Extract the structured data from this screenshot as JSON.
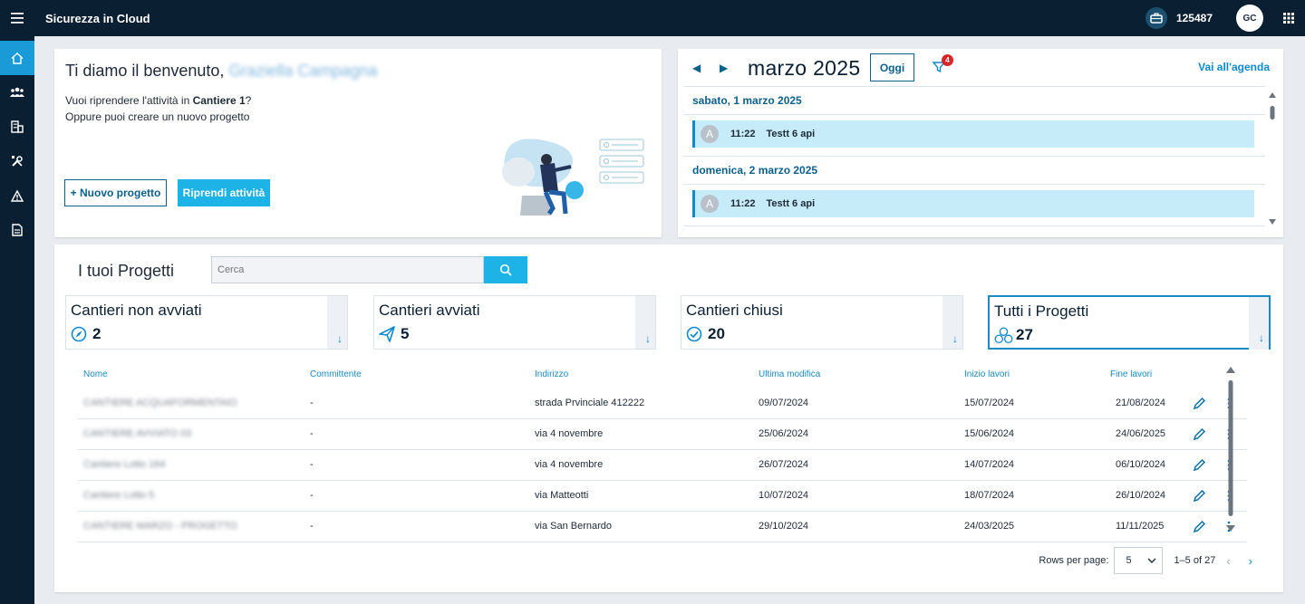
{
  "app": {
    "title": "Sicurezza in Cloud",
    "code": "125487",
    "user_initials": "GC"
  },
  "sidebar": {
    "items": [
      {
        "icon": "home-icon",
        "active": true
      },
      {
        "icon": "users-icon",
        "active": false
      },
      {
        "icon": "buildings-icon",
        "active": false
      },
      {
        "icon": "tools-icon",
        "active": false
      },
      {
        "icon": "warning-icon",
        "active": false
      },
      {
        "icon": "document-icon",
        "active": false
      }
    ]
  },
  "welcome": {
    "greeting": "Ti diamo il benvenuto,",
    "user_name": "Graziella Campagna",
    "resume_prefix": "Vuoi riprendere l'attività in ",
    "resume_site": "Cantiere 1",
    "resume_suffix": "?",
    "create_line": "Oppure puoi creare un nuovo progetto",
    "new_project_label": "+ Nuovo progetto",
    "resume_label": "Riprendi attività"
  },
  "agenda": {
    "month": "marzo 2025",
    "today_label": "Oggi",
    "filter_count": "4",
    "goto_label": "Vai all'agenda",
    "days": [
      {
        "label": "sabato, 1 marzo 2025",
        "events": [
          {
            "avatar": "A",
            "time": "11:22",
            "title": "Testt 6 api"
          }
        ]
      },
      {
        "label": "domenica, 2 marzo 2025",
        "events": [
          {
            "avatar": "A",
            "time": "11:22",
            "title": "Testt 6 api"
          }
        ]
      }
    ]
  },
  "projects": {
    "title": "I tuoi Progetti",
    "search_placeholder": "Cerca",
    "tiles": [
      {
        "label": "Cantieri non avviati",
        "count": "2",
        "icon": "compass-icon",
        "selected": false
      },
      {
        "label": "Cantieri avviati",
        "count": "5",
        "icon": "paper-plane-icon",
        "selected": false
      },
      {
        "label": "Cantieri chiusi",
        "count": "20",
        "icon": "check-circle-icon",
        "selected": false
      },
      {
        "label": "Tutti i Progetti",
        "count": "27",
        "icon": "circles-icon",
        "selected": true
      }
    ],
    "columns": [
      "Nome",
      "Committente",
      "Indirizzo",
      "Ultima modifica",
      "Inizio lavori",
      "Fine lavori"
    ],
    "rows": [
      {
        "name": "CANTIERE ACQUAFORMENTAIO",
        "client": "-",
        "address": "strada Prvinciale 412222",
        "modified": "09/07/2024",
        "start": "15/07/2024",
        "end": "21/08/2024"
      },
      {
        "name": "CANTIERE AVVIATO 03",
        "client": "-",
        "address": "via 4 novembre",
        "modified": "25/06/2024",
        "start": "15/06/2024",
        "end": "24/06/2025"
      },
      {
        "name": "Cantiere Lotto 164",
        "client": "-",
        "address": "via 4 novembre",
        "modified": "26/07/2024",
        "start": "14/07/2024",
        "end": "06/10/2024"
      },
      {
        "name": "Cantiere Lotto 5",
        "client": "-",
        "address": "via Matteotti",
        "modified": "10/07/2024",
        "start": "18/07/2024",
        "end": "26/10/2024"
      },
      {
        "name": "CANTIERE MARZO - PROGETTO",
        "client": "-",
        "address": "via San Bernardo",
        "modified": "29/10/2024",
        "start": "24/03/2025",
        "end": "11/11/2025"
      }
    ],
    "pager": {
      "rows_label": "Rows per page:",
      "rows_value": "5",
      "range": "1–5 of 27"
    }
  }
}
